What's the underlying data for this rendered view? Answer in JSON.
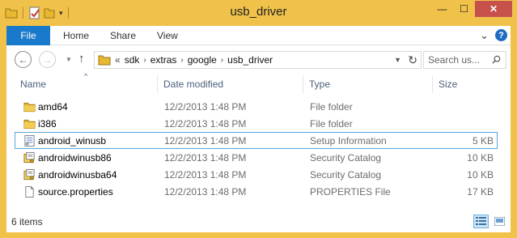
{
  "window": {
    "title": "usb_driver",
    "minimize": "—",
    "maximize": "☐",
    "close": "✕"
  },
  "ribbon": {
    "tabs": [
      {
        "label": "File"
      },
      {
        "label": "Home"
      },
      {
        "label": "Share"
      },
      {
        "label": "View"
      }
    ],
    "expand_glyph": "⌄",
    "help_glyph": "?"
  },
  "nav": {
    "back_glyph": "←",
    "forward_glyph": "→",
    "recent_glyph": "▼",
    "up_glyph": "↑",
    "path_prefix": "«",
    "breadcrumb": [
      "sdk",
      "extras",
      "google",
      "usb_driver"
    ],
    "separator": "›",
    "address_dropdown": "▼",
    "refresh_glyph": "↻"
  },
  "search": {
    "placeholder": "Search us..."
  },
  "columns": {
    "name": "Name",
    "date": "Date modified",
    "type": "Type",
    "size": "Size"
  },
  "files": [
    {
      "name": "amd64",
      "date": "12/2/2013 1:48 PM",
      "type": "File folder",
      "size": "",
      "icon": "folder-icon"
    },
    {
      "name": "i386",
      "date": "12/2/2013 1:48 PM",
      "type": "File folder",
      "size": "",
      "icon": "folder-icon"
    },
    {
      "name": "android_winusb",
      "date": "12/2/2013 1:48 PM",
      "type": "Setup Information",
      "size": "5 KB",
      "icon": "setup-information-icon",
      "selected": true
    },
    {
      "name": "androidwinusb86",
      "date": "12/2/2013 1:48 PM",
      "type": "Security Catalog",
      "size": "10 KB",
      "icon": "security-catalog-icon"
    },
    {
      "name": "androidwinusba64",
      "date": "12/2/2013 1:48 PM",
      "type": "Security Catalog",
      "size": "10 KB",
      "icon": "security-catalog-icon"
    },
    {
      "name": "source.properties",
      "date": "12/2/2013 1:48 PM",
      "type": "PROPERTIES File",
      "size": "17 KB",
      "icon": "document-icon"
    }
  ],
  "status": {
    "item_count": "6 items"
  },
  "colors": {
    "frame": "#f0c24a",
    "file_tab": "#1979ca",
    "close_button": "#c7504b",
    "selection_border": "#5ba4d9"
  }
}
